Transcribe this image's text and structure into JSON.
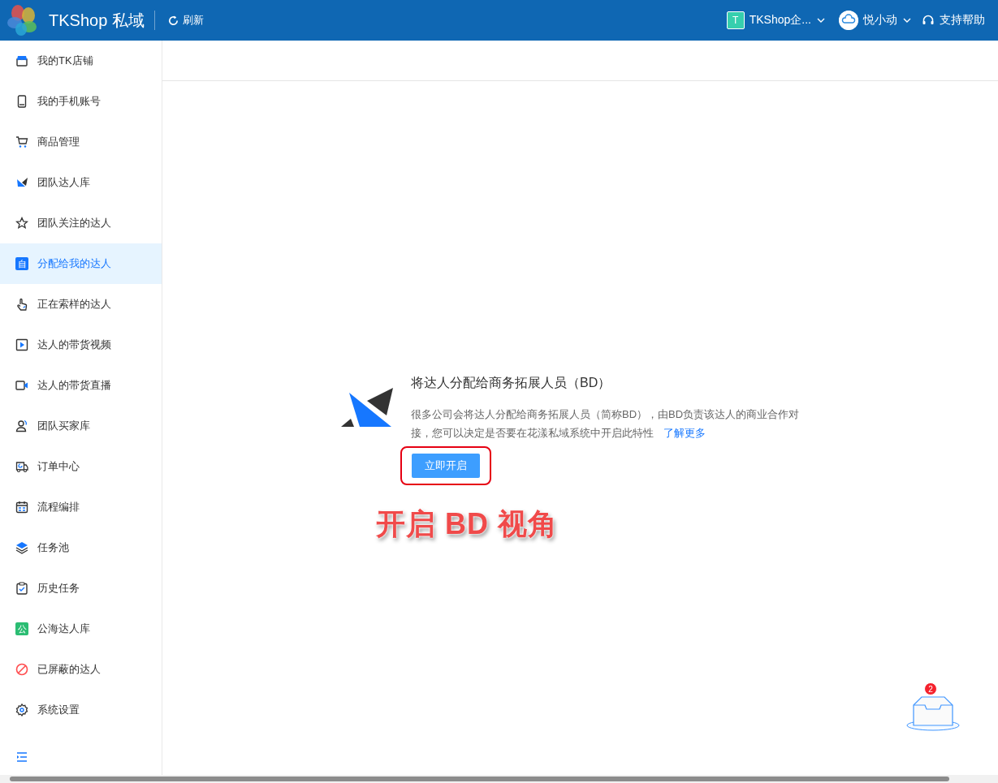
{
  "header": {
    "app_name": "TKShop 私域",
    "refresh": "刷新",
    "team": {
      "initial": "T",
      "name": "TKShop企..."
    },
    "user": {
      "name": "悦小动"
    },
    "help": "支持帮助"
  },
  "sidebar": {
    "items": [
      {
        "label": "我的TK店铺",
        "selected": false
      },
      {
        "label": "我的手机账号",
        "selected": false
      },
      {
        "label": "商品管理",
        "selected": false
      },
      {
        "label": "团队达人库",
        "selected": false
      },
      {
        "label": "团队关注的达人",
        "selected": false
      },
      {
        "label": "分配给我的达人",
        "selected": true,
        "icon_glyph": "自"
      },
      {
        "label": "正在索样的达人",
        "selected": false
      },
      {
        "label": "达人的带货视频",
        "selected": false
      },
      {
        "label": "达人的带货直播",
        "selected": false
      },
      {
        "label": "团队买家库",
        "selected": false
      },
      {
        "label": "订单中心",
        "selected": false
      },
      {
        "label": "流程编排",
        "selected": false
      },
      {
        "label": "任务池",
        "selected": false
      },
      {
        "label": "历史任务",
        "selected": false
      },
      {
        "label": "公海达人库",
        "selected": false,
        "icon_glyph": "公"
      },
      {
        "label": "已屏蔽的达人",
        "selected": false
      },
      {
        "label": "系统设置",
        "selected": false
      }
    ]
  },
  "feature_card": {
    "title": "将达人分配给商务拓展人员（BD）",
    "description": "很多公司会将达人分配给商务拓展人员（简称BD），由BD负责该达人的商业合作对接，您可以决定是否要在花漾私域系统中开启此特性",
    "link": "了解更多",
    "button": "立即开启"
  },
  "annotation": {
    "text": "开启 BD 视角"
  },
  "inbox_widget": {
    "badge": "2"
  }
}
